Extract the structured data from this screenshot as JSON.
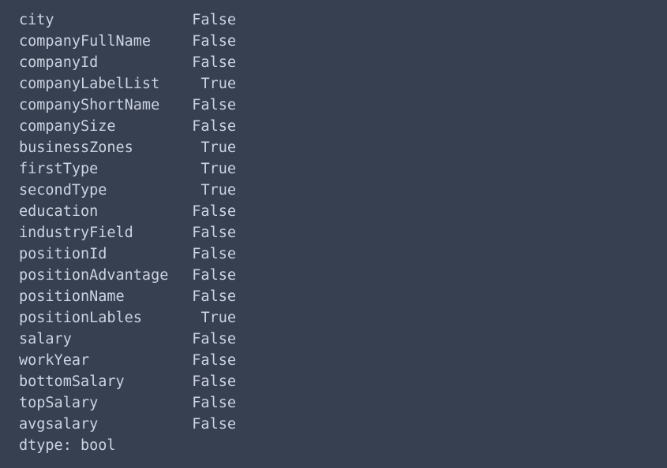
{
  "console": {
    "background_color": "#374050",
    "text_color": "#ccd3e2",
    "series": {
      "rows": [
        {
          "index": "city",
          "value": "False"
        },
        {
          "index": "companyFullName",
          "value": "False"
        },
        {
          "index": "companyId",
          "value": "False"
        },
        {
          "index": "companyLabelList",
          "value": "True"
        },
        {
          "index": "companyShortName",
          "value": "False"
        },
        {
          "index": "companySize",
          "value": "False"
        },
        {
          "index": "businessZones",
          "value": "True"
        },
        {
          "index": "firstType",
          "value": "True"
        },
        {
          "index": "secondType",
          "value": "True"
        },
        {
          "index": "education",
          "value": "False"
        },
        {
          "index": "industryField",
          "value": "False"
        },
        {
          "index": "positionId",
          "value": "False"
        },
        {
          "index": "positionAdvantage",
          "value": "False"
        },
        {
          "index": "positionName",
          "value": "False"
        },
        {
          "index": "positionLables",
          "value": "True"
        },
        {
          "index": "salary",
          "value": "False"
        },
        {
          "index": "workYear",
          "value": "False"
        },
        {
          "index": "bottomSalary",
          "value": "False"
        },
        {
          "index": "topSalary",
          "value": "False"
        },
        {
          "index": "avgsalary",
          "value": "False"
        }
      ],
      "dtype_line": "dtype: bool"
    }
  }
}
